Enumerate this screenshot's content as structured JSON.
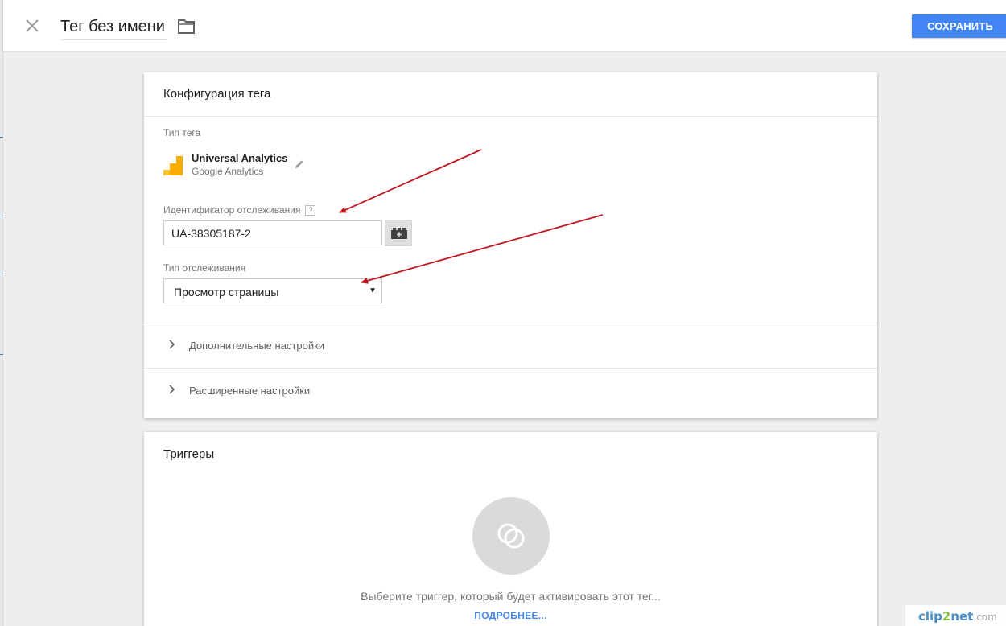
{
  "header": {
    "tag_name": "Тег без имени",
    "save_label": "СОХРАНИТЬ",
    "icons": {
      "close": "close-icon",
      "folder": "folder-icon"
    }
  },
  "config": {
    "title": "Конфигурация тега",
    "tag_type_label": "Тип тега",
    "tag_type": {
      "name": "Universal Analytics",
      "provider": "Google Analytics",
      "icon": "universal-analytics-icon"
    },
    "tracking_id_label": "Идентификатор отслеживания",
    "help": "?",
    "tracking_id_value": "UA-38305187-2",
    "tracking_type_label": "Тип отслеживания",
    "tracking_type_value": "Просмотр страницы",
    "sections": [
      "Дополнительные настройки",
      "Расширенные настройки"
    ]
  },
  "triggers": {
    "title": "Триггеры",
    "hint": "Выберите триггер, который будет активировать этот тег...",
    "more_link": "ПОДРОБНЕЕ..."
  },
  "watermark": {
    "part1": "clip",
    "part2": "2",
    "part3": "net",
    "part4": ".com"
  },
  "colors": {
    "accent": "#4285f4",
    "ua_orange": "#f9ab00",
    "ua_yellow": "#fbc02d",
    "arrow": "#c0181f"
  }
}
